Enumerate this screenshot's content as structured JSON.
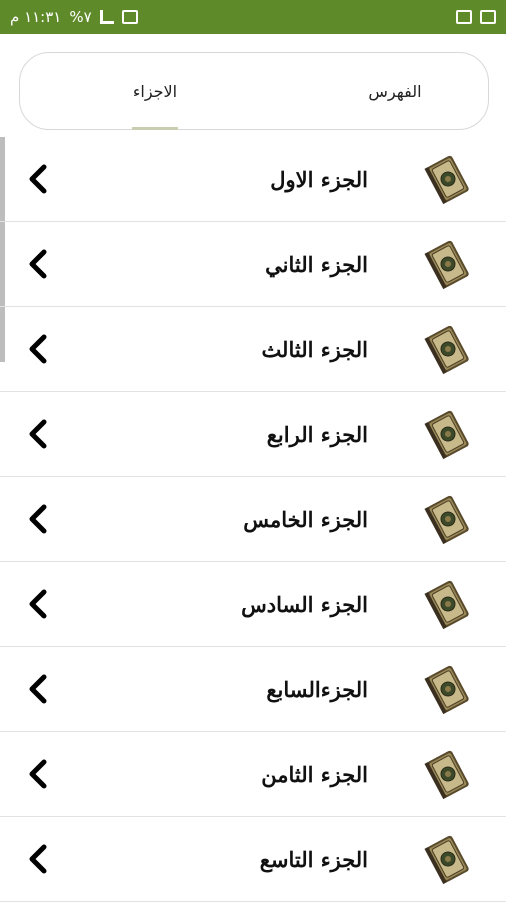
{
  "status_bar": {
    "time": "١١:٣١ م",
    "battery": "%٧"
  },
  "tabs": [
    {
      "label": "الفهرس",
      "selected": false
    },
    {
      "label": "الاجزاء",
      "selected": true
    }
  ],
  "parts": [
    {
      "label": "الجزء الاول"
    },
    {
      "label": "الجزء الثاني"
    },
    {
      "label": "الجزء الثالث"
    },
    {
      "label": "الجزء الرابع"
    },
    {
      "label": "الجزء الخامس"
    },
    {
      "label": "الجزء السادس"
    },
    {
      "label": "الجزءالسابع"
    },
    {
      "label": "الجزء الثامن"
    },
    {
      "label": "الجزء التاسع"
    }
  ],
  "colors": {
    "status_bar": "#5f8a2a",
    "tab_underline": "#c8ceb0"
  },
  "icons": {
    "row_icon": "quran-book-icon",
    "row_arrow": "chevron-left-icon"
  }
}
